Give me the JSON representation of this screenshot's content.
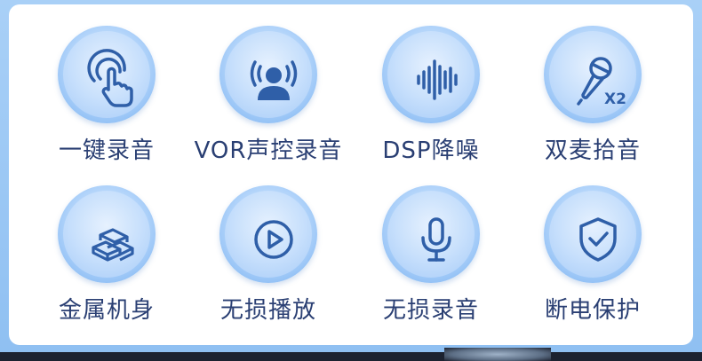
{
  "features": [
    {
      "label": "一键录音",
      "icon": "one-touch-record-icon"
    },
    {
      "label": "VOR声控录音",
      "icon": "voice-activated-record-icon"
    },
    {
      "label": "DSP降噪",
      "icon": "noise-reduction-waveform-icon"
    },
    {
      "label": "双麦拾音",
      "icon": "dual-mic-icon",
      "badge": "X2"
    },
    {
      "label": "金属机身",
      "icon": "metal-bars-icon"
    },
    {
      "label": "无损播放",
      "icon": "play-icon"
    },
    {
      "label": "无损录音",
      "icon": "microphone-icon"
    },
    {
      "label": "断电保护",
      "icon": "shield-check-icon"
    }
  ],
  "colors": {
    "icon": "#2f5fa8",
    "label": "#2a3f73",
    "frame": "#a9d0f7"
  }
}
